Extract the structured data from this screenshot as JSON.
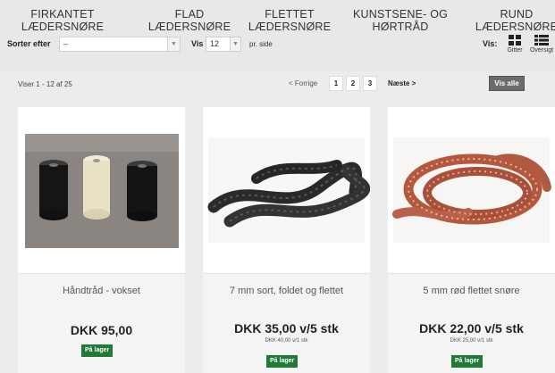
{
  "categories": [
    {
      "line1": "FIRKANTET",
      "line2": "LÆDERSNØRE"
    },
    {
      "line1": "FLAD",
      "line2": "LÆDERSNØRE"
    },
    {
      "line1": "FLETTET",
      "line2": "LÆDERSNØRE"
    },
    {
      "line1": "KUNSTSENE- OG",
      "line2": "HØRTRÅD"
    },
    {
      "line1": "RUND",
      "line2": "LÆDERSNØRE"
    }
  ],
  "toolbar": {
    "sort_label": "Sorter efter",
    "sort_value": "–",
    "show_label": "Vis",
    "per_page_value": "12",
    "per_page_suffix": "pr. side",
    "view_label": "Vis:",
    "view_grid_label": "Gitter",
    "view_list_label": "Oversigt"
  },
  "pager": {
    "count_text": "Viser 1 - 12 af 25",
    "prev_label": "< Forrige",
    "pages": [
      "1",
      "2",
      "3"
    ],
    "next_label": "Næste >",
    "view_all_label": "Vis alle"
  },
  "products": [
    {
      "name": "Håndtråd - vokset",
      "price": "DKK 95,00",
      "subprice": "",
      "stock": "På lager"
    },
    {
      "name": "7 mm sort, foldet og flettet",
      "price": "DKK 35,00 v/5 stk",
      "subprice": "DKK 40,00 v/1 stk",
      "stock": "På lager"
    },
    {
      "name": "5 mm rød flettet snøre",
      "price": "DKK 22,00 v/5 stk",
      "subprice": "DKK 25,00 v/1 stk",
      "stock": "På lager"
    }
  ],
  "colors": {
    "stock_badge": "#1f7a36",
    "view_all_button": "#6b6b6b",
    "background": "#ececec"
  }
}
